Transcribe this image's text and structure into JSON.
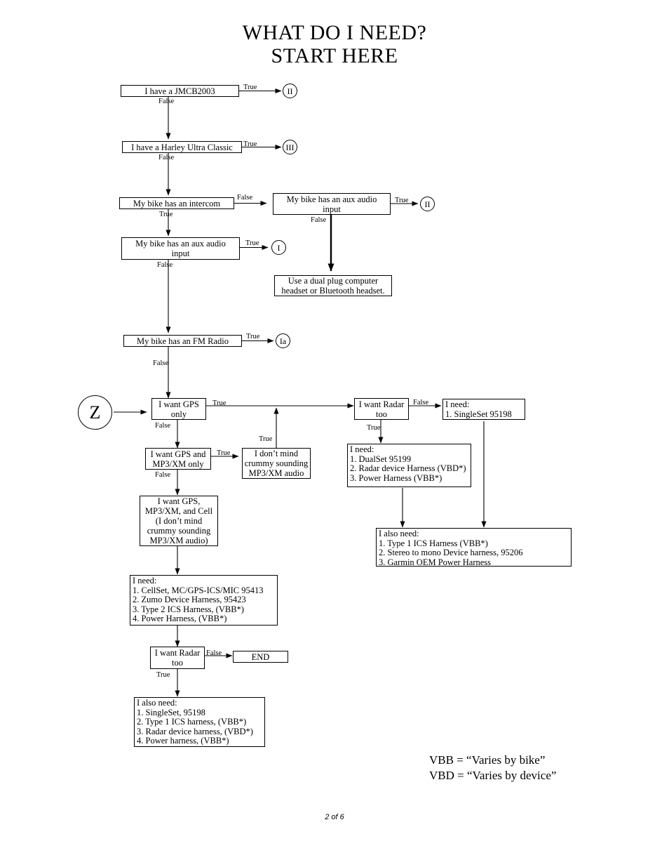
{
  "document": {
    "title": "WHAT DO I NEED?\nSTART HERE",
    "footer_page": "2 of 6"
  },
  "legend": {
    "text": "VBB = “Varies by bike”\nVBD = “Varies by device”"
  },
  "nodes": {
    "jmcb2003": "I have a JMCB2003",
    "harley_ultra": "I have a Harley Ultra Classic",
    "intercom": "My bike has an intercom",
    "aux_audio_right": "My bike has an aux audio\ninput",
    "aux_audio_left": "My bike has an aux audio\ninput",
    "dual_plug": "Use a dual plug computer\nheadset or Bluetooth headset.",
    "fm_radio": "My bike has an FM Radio",
    "gps_only": "I want GPS\nonly",
    "gps_mp3": "I want GPS and\nMP3/XM  only",
    "crummy_audio": "I don’t mind\ncrummy sounding\nMP3/XM audio",
    "gps_mp3_cell": "I want GPS,\nMP3/XM, and Cell\n(I don’t mind\ncrummy sounding\nMP3/XM audio)",
    "radar_top": "I want Radar\ntoo",
    "radar_bottom": "I want Radar\ntoo",
    "need_singleset": "I need:\n1. SingleSet 95198",
    "need_dualset": "I need:\n1. DualSet 95199\n2. Radar device Harness (VBD*)\n3. Power Harness (VBB*)",
    "also_need_right": "I also need:\n1. Type 1 ICS Harness (VBB*)\n2. Stereo to mono Device harness, 95206\n3. Garmin OEM Power Harness",
    "need_cellset": "I need:\n1. CellSet, MC/GPS-ICS/MIC 95413\n2. Zumo Device Harness, 95423\n3. Type 2 ICS Harness, (VBB*)\n4. Power Harness, (VBB*)",
    "also_need_bottom": "I also need:\n1. SingleSet, 95198\n2. Type 1 ICS harness, (VBB*)\n3. Radar device harness, (VBD*)\n4. Power harness, (VBB*)",
    "end": "END"
  },
  "connectors": {
    "circle_II_top": "II",
    "circle_III": "III",
    "circle_II_mid": "II",
    "circle_I": "I",
    "circle_Ia": "Ia",
    "circle_Z": "Z"
  },
  "edge_labels": {
    "jmcb_true": "True",
    "jmcb_false": "False",
    "harley_true": "True",
    "harley_false": "False",
    "intercom_false": "False",
    "intercom_true": "True",
    "aux_right_true": "True",
    "aux_right_false": "False",
    "aux_left_true": "True",
    "aux_left_false": "False",
    "fm_true": "True",
    "fm_false": "False",
    "gps_only_true": "True",
    "gps_only_false": "False",
    "gps_mp3_true": "True",
    "gps_mp3_false": "False",
    "crummy_true": "True",
    "radar_top_false": "False",
    "radar_top_true": "True",
    "radar_bottom_false": "False",
    "radar_bottom_true": "True"
  },
  "colors": {
    "stroke": "#000000",
    "background": "#ffffff"
  }
}
